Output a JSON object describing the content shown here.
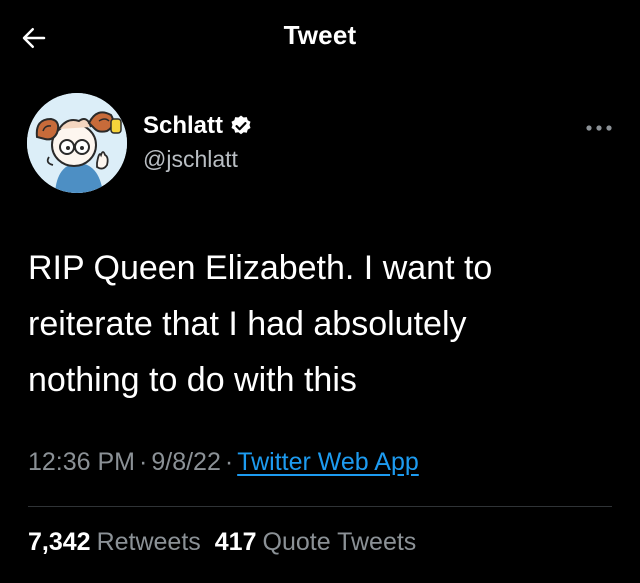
{
  "header": {
    "title": "Tweet",
    "back_icon": "arrow-left-icon"
  },
  "author": {
    "display_name": "Schlatt",
    "handle": "@jschlatt",
    "verified": true,
    "verified_icon": "verified-badge-icon",
    "avatar_icon": "avatar-cartoon-ram-icon"
  },
  "more_icon": "more-options-icon",
  "tweet": {
    "text": "RIP Queen Elizabeth. I want to\nreiterate that I had absolutely\nnothing to do with this"
  },
  "meta": {
    "time": "12:36 PM",
    "separator": "·",
    "date": "9/8/22",
    "source": "Twitter Web App"
  },
  "stats": {
    "retweets_count": "7,342",
    "retweets_label": "Retweets",
    "quotes_count": "417",
    "quotes_label": "Quote Tweets"
  },
  "colors": {
    "background": "#000000",
    "text": "#ffffff",
    "secondary": "#8b9196",
    "link": "#1d9bf0",
    "divider": "#2f3336"
  }
}
